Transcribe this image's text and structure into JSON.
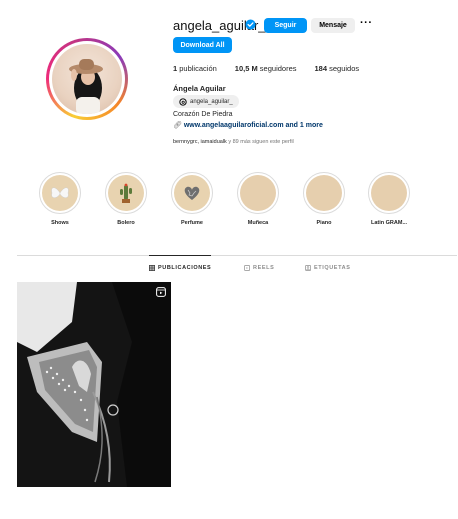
{
  "profile": {
    "username": "angela_aguilar_",
    "full_name": "Ángela Aguilar",
    "threads_handle": "angela_aguilar_",
    "bio": "Corazón De Piedra",
    "link_text": "www.angelaaguilaroficial.com and 1 more",
    "followed_by_names": "bernnygrc, iamaidualk",
    "followed_by_suffix": " y 89 más siguen este perfil"
  },
  "actions": {
    "follow_label": "Seguir",
    "message_label": "Mensaje",
    "more_label": "···",
    "download_label": "Download All"
  },
  "stats": {
    "posts_value": "1",
    "posts_label": " publicación",
    "followers_value": "10,5 M",
    "followers_label": " seguidores",
    "following_value": "184",
    "following_label": " seguidos"
  },
  "highlights": [
    {
      "label": "Shows",
      "icon": "butterfly-icon"
    },
    {
      "label": "Bolero",
      "icon": "cactus-icon"
    },
    {
      "label": "Perfume",
      "icon": "heart-icon"
    },
    {
      "label": "Muñeca",
      "icon": "blank-icon"
    },
    {
      "label": "Piano",
      "icon": "blank-icon"
    },
    {
      "label": "Latin GRAM...",
      "icon": "blank-icon"
    }
  ],
  "tabs": {
    "posts": "PUBLICACIONES",
    "reels": "REELS",
    "tagged": "ETIQUETAS"
  },
  "colors": {
    "primary_button": "#0095f6",
    "secondary_button": "#efefef",
    "link": "#00376b",
    "muted_text": "#737373",
    "highlight_fill": "#e6cfae"
  }
}
